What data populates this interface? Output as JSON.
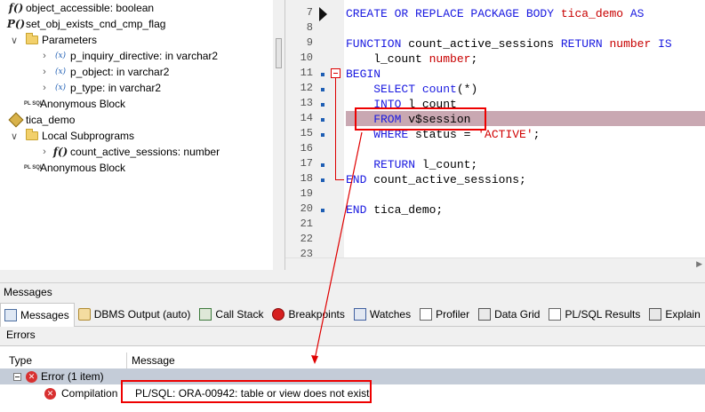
{
  "tree": {
    "items": [
      {
        "label": "object_accessible: boolean",
        "icon": "function-icon"
      },
      {
        "label": "set_obj_exists_cnd_cmp_flag",
        "icon": "procedure-icon"
      },
      {
        "label": "Parameters",
        "icon": "folder-icon"
      },
      {
        "label": "p_inquiry_directive: in varchar2",
        "icon": "variable-icon"
      },
      {
        "label": "p_object: in varchar2",
        "icon": "variable-icon"
      },
      {
        "label": "p_type: in varchar2",
        "icon": "variable-icon"
      },
      {
        "label": "Anonymous Block",
        "icon": "plsql-block-icon"
      },
      {
        "label": "tica_demo",
        "icon": "package-icon"
      },
      {
        "label": "Local Subprograms",
        "icon": "folder-icon"
      },
      {
        "label": "count_active_sessions: number",
        "icon": "function-icon"
      },
      {
        "label": "Anonymous Block",
        "icon": "plsql-block-icon"
      }
    ],
    "icon_glyphs": {
      "function": "f()",
      "procedure": "P()",
      "variable": "(x)",
      "plsql": "PL SQL"
    }
  },
  "editor": {
    "line_numbers": [
      "7",
      "8",
      "9",
      "10",
      "11",
      "12",
      "13",
      "14",
      "15",
      "16",
      "17",
      "18",
      "19",
      "20",
      "21",
      "22",
      "23"
    ],
    "code": [
      [
        {
          "t": "CREATE OR REPLACE PACKAGE BODY ",
          "c": "kw"
        },
        {
          "t": "tica_demo",
          "c": "tp"
        },
        {
          "t": " AS",
          "c": "kw"
        }
      ],
      [],
      [
        {
          "t": "FUNCTION ",
          "c": "kw"
        },
        {
          "t": "count_active_sessions ",
          "c": "nm"
        },
        {
          "t": "RETURN ",
          "c": "kw"
        },
        {
          "t": "number",
          "c": "tp"
        },
        {
          "t": " IS",
          "c": "kw"
        }
      ],
      [
        {
          "t": "    l_count ",
          "c": "nm"
        },
        {
          "t": "number",
          "c": "tp"
        },
        {
          "t": ";",
          "c": "nm"
        }
      ],
      [
        {
          "t": "BEGIN",
          "c": "kw"
        }
      ],
      [
        {
          "t": "    SELECT ",
          "c": "kw"
        },
        {
          "t": "count",
          "c": "kw"
        },
        {
          "t": "(*)",
          "c": "nm"
        }
      ],
      [
        {
          "t": "    INTO ",
          "c": "kw"
        },
        {
          "t": "l_count",
          "c": "nm"
        }
      ],
      [
        {
          "t": "    FROM ",
          "c": "kw"
        },
        {
          "t": "v$session",
          "c": "nm"
        }
      ],
      [
        {
          "t": "    WHERE ",
          "c": "kw"
        },
        {
          "t": "status = ",
          "c": "nm"
        },
        {
          "t": "'ACTIVE'",
          "c": "str"
        },
        {
          "t": ";",
          "c": "nm"
        }
      ],
      [],
      [
        {
          "t": "    RETURN ",
          "c": "kw"
        },
        {
          "t": "l_count;",
          "c": "nm"
        }
      ],
      [
        {
          "t": "END ",
          "c": "kw"
        },
        {
          "t": "count_active_sessions;",
          "c": "nm"
        }
      ],
      [],
      [
        {
          "t": "END ",
          "c": "kw"
        },
        {
          "t": "tica_demo;",
          "c": "nm"
        }
      ],
      [],
      [],
      []
    ],
    "bullet_lines": [
      "11",
      "12",
      "13",
      "14",
      "15",
      "17",
      "18",
      "20"
    ],
    "highlighted_line": "14"
  },
  "messages": {
    "title": "Messages",
    "tabs": [
      {
        "label": "Messages",
        "icon": "messages-icon",
        "active": true
      },
      {
        "label": "DBMS Output (auto)",
        "icon": "dbms-output-icon"
      },
      {
        "label": "Call Stack",
        "icon": "call-stack-icon"
      },
      {
        "label": "Breakpoints",
        "icon": "breakpoints-icon"
      },
      {
        "label": "Watches",
        "icon": "watches-icon"
      },
      {
        "label": "Profiler",
        "icon": "profiler-icon"
      },
      {
        "label": "Data Grid",
        "icon": "data-grid-icon"
      },
      {
        "label": "PL/SQL Results",
        "icon": "plsql-results-icon"
      },
      {
        "label": "Explain",
        "icon": "explain-icon"
      }
    ],
    "subtab": "Errors",
    "columns": [
      "Type",
      "Message"
    ],
    "group_label": "Error (1 item)",
    "row": {
      "type": "Compilation",
      "message": "PL/SQL: ORA-00942: table or view does not exist"
    },
    "error_glyph": "✕"
  },
  "colors": {
    "keyword": "#1a1ae0",
    "type": "#c80000",
    "highlight_row": "#c9a8b2",
    "annotation": "#e00000",
    "group_row": "#c4ccd8"
  }
}
